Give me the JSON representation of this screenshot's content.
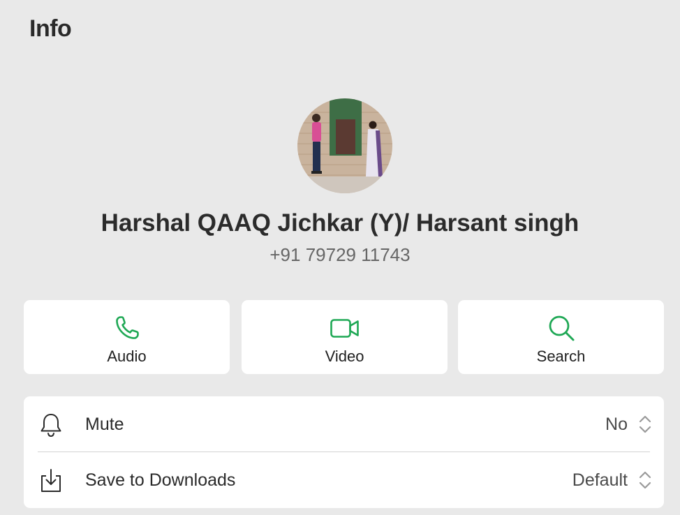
{
  "header": {
    "title": "Info"
  },
  "contact": {
    "name": "Harshal QAAQ Jichkar (Y)/ Harsant singh",
    "phone": "+91 79729 11743",
    "avatar_icon": "contact-photo"
  },
  "actions": [
    {
      "label": "Audio",
      "icon": "phone-icon"
    },
    {
      "label": "Video",
      "icon": "video-camera-icon"
    },
    {
      "label": "Search",
      "icon": "search-icon"
    }
  ],
  "settings": {
    "mute": {
      "label": "Mute",
      "value": "No",
      "icon": "bell-icon"
    },
    "downloads": {
      "label": "Save to Downloads",
      "value": "Default",
      "icon": "download-tray-icon"
    }
  },
  "colors": {
    "background": "#e9e9e9",
    "card": "#ffffff",
    "accent_green": "#1fa855",
    "text_primary": "#2a2a2a",
    "text_secondary": "#666666"
  }
}
